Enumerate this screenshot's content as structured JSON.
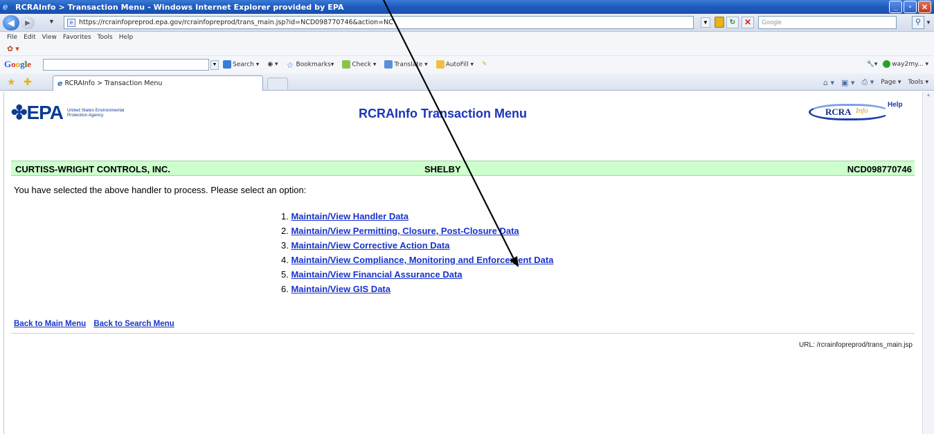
{
  "window": {
    "title": "RCRAInfo > Transaction Menu - Windows Internet Explorer provided by EPA",
    "min_glyph": "_",
    "max_glyph": "▫",
    "close_glyph": "✕"
  },
  "address_bar": {
    "url": "https://rcrainfopreprod.epa.gov/rcrainfopreprod/trans_main.jsp?id=NCD098770746&action=NC",
    "search_placeholder": "Google"
  },
  "menu": {
    "items": [
      "File",
      "Edit",
      "View",
      "Favorites",
      "Tools",
      "Help"
    ]
  },
  "google_toolbar": {
    "logo": [
      "G",
      "o",
      "o",
      "g",
      "l",
      "e"
    ],
    "tools": [
      "Search ▾",
      "Bookmarks▾",
      "Check ▾",
      "Translate ▾",
      "AutoFill ▾"
    ],
    "user": "way2my..."
  },
  "tabs": {
    "active_label": "RCRAInfo > Transaction Menu"
  },
  "command_bar": {
    "page_label": "Page ▾",
    "tools_label": "Tools ▾"
  },
  "page": {
    "epa_mark": "EPA",
    "epa_subtitle": "United States Environmental Protection Agency",
    "title": "RCRAInfo Transaction Menu",
    "rcra_logo_text": "RCRA",
    "rcra_logo_info": "Info",
    "help_label": "Help",
    "handler": {
      "name": "CURTISS-WRIGHT CONTROLS, INC.",
      "city": "SHELBY",
      "id": "NCD098770746"
    },
    "instructions": "You have selected the above handler to process.  Please select an option:",
    "options": [
      {
        "num": "1.",
        "label": "Maintain/View Handler Data"
      },
      {
        "num": "2.",
        "label": "Maintain/View Permitting, Closure, Post-Closure Data"
      },
      {
        "num": "3.",
        "label": "Maintain/View Corrective Action Data"
      },
      {
        "num": "4.",
        "label": "Maintain/View Compliance, Monitoring and Enforcement Data"
      },
      {
        "num": "5.",
        "label": "Maintain/View Financial Assurance Data"
      },
      {
        "num": "6.",
        "label": "Maintain/View GIS Data"
      }
    ],
    "back_main": "Back to Main Menu",
    "back_search": "Back to Search Menu",
    "url_note": "URL: /rcrainfopreprod/trans_main.jsp"
  },
  "colors": {
    "link": "#1a33c8",
    "title_blue": "#1a35b8",
    "handler_band": "#ccffcc",
    "arrow": "#000000"
  }
}
